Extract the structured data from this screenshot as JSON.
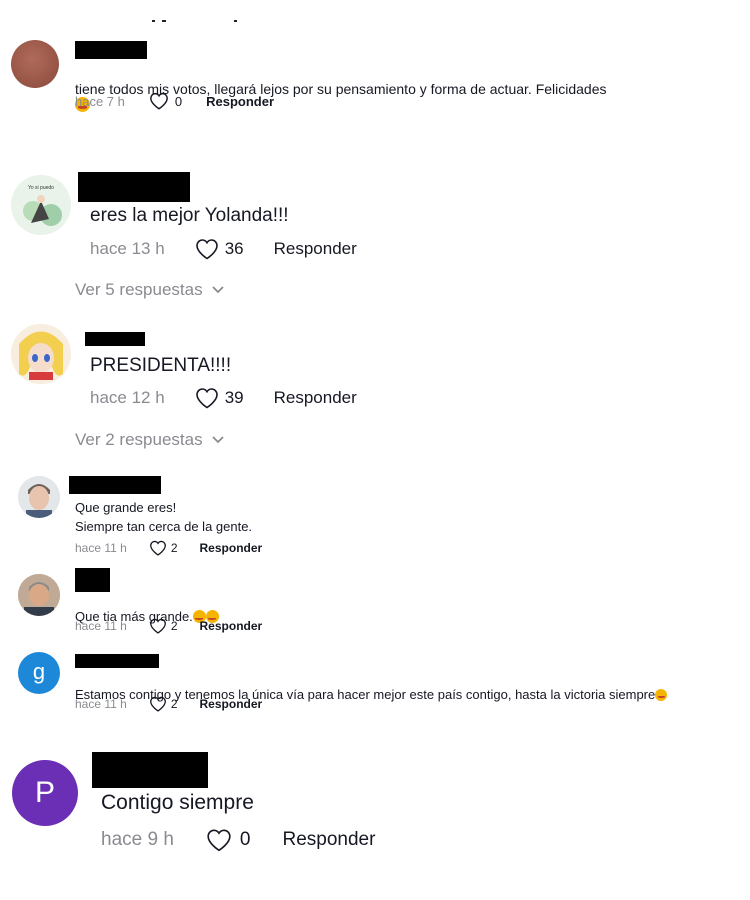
{
  "like_label_hidden": "",
  "comments": [
    {
      "text": "tiene todos mis votos, llegará lejos por su pensamiento y forma de actuar. Felicidades",
      "emoji": "🥰",
      "time": "hace 7 h",
      "likes": "0",
      "reply": "Responder"
    },
    {
      "text": "eres la mejor Yolanda!!!",
      "time": "hace 13 h",
      "likes": "36",
      "reply": "Responder",
      "view_replies": "Ver 5 respuestas"
    },
    {
      "text": "PRESIDENTA!!!!",
      "time": "hace 12 h",
      "likes": "39",
      "reply": "Responder",
      "view_replies": "Ver 2 respuestas"
    },
    {
      "text": "Que grande eres!\nSiempre tan cerca de la gente.",
      "time": "hace 11 h",
      "likes": "2",
      "reply": "Responder"
    },
    {
      "text": "Que tia más grande.",
      "emoji": "🥰🥰",
      "time": "hace 11 h",
      "likes": "2",
      "reply": "Responder"
    },
    {
      "text": "Estamos contigo y tenemos la única vía para hacer mejor este país contigo, hasta la victoria siempre",
      "emoji": "😏",
      "time": "hace 11 h",
      "likes": "2",
      "reply": "Responder",
      "avatar_letter": "g"
    },
    {
      "text": "Contigo siempre",
      "time": "hace 9 h",
      "likes": "0",
      "reply": "Responder",
      "avatar_letter": "P"
    }
  ],
  "avatar_art_text": "Yo si puedo"
}
